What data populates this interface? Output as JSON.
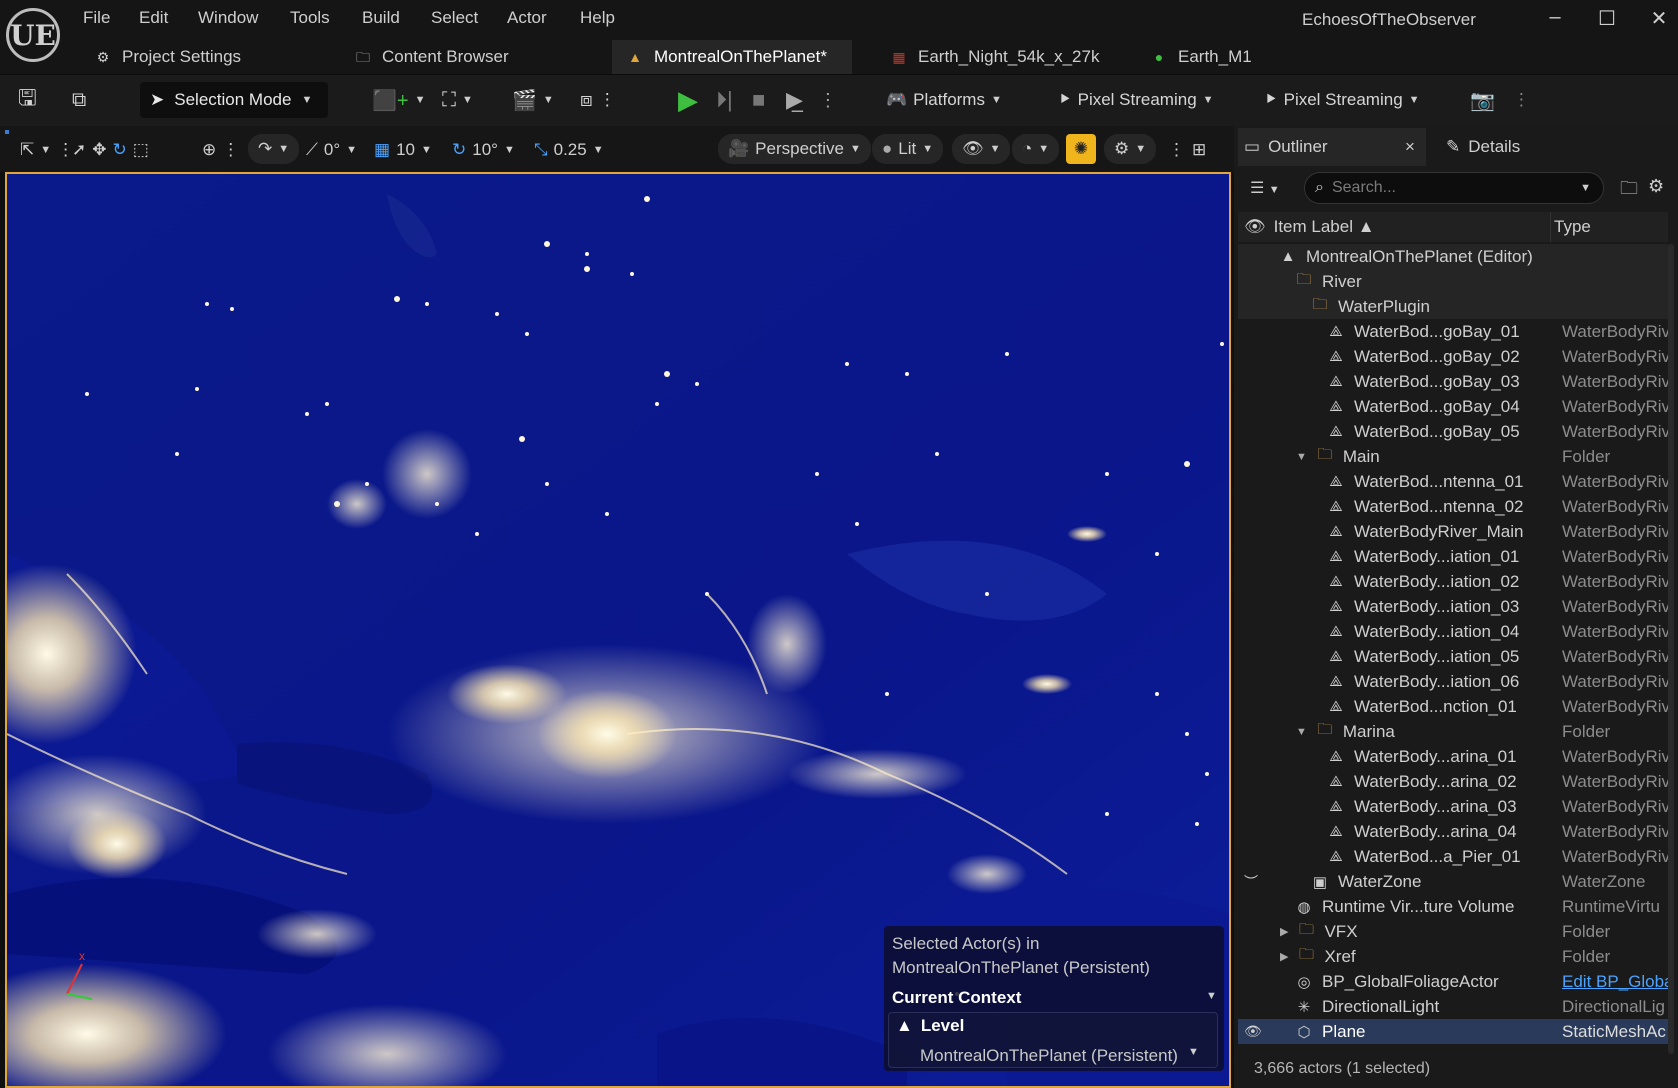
{
  "app": {
    "window_title": "EchoesOfTheObserver",
    "logo": "UE"
  },
  "menu": [
    "File",
    "Edit",
    "Window",
    "Tools",
    "Build",
    "Select",
    "Actor",
    "Help"
  ],
  "window_controls": {
    "minimize": "–",
    "maximize": "☐",
    "close": "✕"
  },
  "tabs": [
    {
      "label": "Project Settings",
      "icon": "gear-icon"
    },
    {
      "label": "Content Browser",
      "icon": "folder-icon"
    },
    {
      "label": "MontrealOnThePlanet*",
      "icon": "level-icon",
      "active": true
    },
    {
      "label": "Earth_Night_54k_x_27k",
      "icon": "texture-icon"
    },
    {
      "label": "Earth_M1",
      "icon": "material-icon"
    }
  ],
  "toolbar": {
    "mode": "Selection Mode",
    "platforms": "Platforms",
    "pixel_streaming_1": "Pixel Streaming",
    "pixel_streaming_2": "Pixel Streaming"
  },
  "viewport_toolbar": {
    "surface_snap": "0°",
    "grid_snap": "10",
    "rotation_snap": "10°",
    "scale_snap": "0.25",
    "view_mode": "Perspective",
    "lighting": "Lit"
  },
  "context_panel": {
    "line1": "Selected Actor(s) in",
    "line2": "MontrealOnThePlanet (Persistent)",
    "header": "Current Context",
    "level_label": "Level",
    "level_value": "MontrealOnThePlanet (Persistent)"
  },
  "outliner": {
    "tab": "Outliner",
    "details_tab": "Details",
    "search_placeholder": "Search...",
    "col_label": "Item Label ▲",
    "col_type": "Type",
    "status": "3,666 actors (1 selected)",
    "rows": [
      {
        "label": "MontrealOnThePlanet (Editor)",
        "type": "",
        "indent": 1,
        "icon": "level",
        "hl": true
      },
      {
        "label": "River",
        "type": "",
        "indent": 2,
        "icon": "folder",
        "hl": true
      },
      {
        "label": "WaterPlugin",
        "type": "",
        "indent": 3,
        "icon": "folder",
        "hl": true
      },
      {
        "label": "WaterBod...goBay_01",
        "type": "WaterBodyRiv",
        "indent": 4,
        "icon": "water"
      },
      {
        "label": "WaterBod...goBay_02",
        "type": "WaterBodyRiv",
        "indent": 4,
        "icon": "water"
      },
      {
        "label": "WaterBod...goBay_03",
        "type": "WaterBodyRiv",
        "indent": 4,
        "icon": "water"
      },
      {
        "label": "WaterBod...goBay_04",
        "type": "WaterBodyRiv",
        "indent": 4,
        "icon": "water"
      },
      {
        "label": "WaterBod...goBay_05",
        "type": "WaterBodyRiv",
        "indent": 4,
        "icon": "water"
      },
      {
        "label": "Main",
        "type": "Folder",
        "indent": 3,
        "icon": "folder",
        "expand": true
      },
      {
        "label": "WaterBod...ntenna_01",
        "type": "WaterBodyRiv",
        "indent": 4,
        "icon": "water"
      },
      {
        "label": "WaterBod...ntenna_02",
        "type": "WaterBodyRiv",
        "indent": 4,
        "icon": "water"
      },
      {
        "label": "WaterBodyRiver_Main",
        "type": "WaterBodyRiv",
        "indent": 4,
        "icon": "water"
      },
      {
        "label": "WaterBody...iation_01",
        "type": "WaterBodyRiv",
        "indent": 4,
        "icon": "water"
      },
      {
        "label": "WaterBody...iation_02",
        "type": "WaterBodyRiv",
        "indent": 4,
        "icon": "water"
      },
      {
        "label": "WaterBody...iation_03",
        "type": "WaterBodyRiv",
        "indent": 4,
        "icon": "water"
      },
      {
        "label": "WaterBody...iation_04",
        "type": "WaterBodyRiv",
        "indent": 4,
        "icon": "water"
      },
      {
        "label": "WaterBody...iation_05",
        "type": "WaterBodyRiv",
        "indent": 4,
        "icon": "water"
      },
      {
        "label": "WaterBody...iation_06",
        "type": "WaterBodyRiv",
        "indent": 4,
        "icon": "water"
      },
      {
        "label": "WaterBod...nction_01",
        "type": "WaterBodyRiv",
        "indent": 4,
        "icon": "water"
      },
      {
        "label": "Marina",
        "type": "Folder",
        "indent": 3,
        "icon": "folder",
        "expand": true
      },
      {
        "label": "WaterBody...arina_01",
        "type": "WaterBodyRiv",
        "indent": 4,
        "icon": "water"
      },
      {
        "label": "WaterBody...arina_02",
        "type": "WaterBodyRiv",
        "indent": 4,
        "icon": "water"
      },
      {
        "label": "WaterBody...arina_03",
        "type": "WaterBodyRiv",
        "indent": 4,
        "icon": "water"
      },
      {
        "label": "WaterBody...arina_04",
        "type": "WaterBodyRiv",
        "indent": 4,
        "icon": "water"
      },
      {
        "label": "WaterBod...a_Pier_01",
        "type": "WaterBodyRiv",
        "indent": 4,
        "icon": "water"
      },
      {
        "label": "WaterZone",
        "type": "WaterZone",
        "indent": 3,
        "icon": "zone",
        "eye": "hidden"
      },
      {
        "label": "Runtime Vir...ture Volume",
        "type": "RuntimeVirtu",
        "indent": 2,
        "icon": "volume"
      },
      {
        "label": "VFX",
        "type": "Folder",
        "indent": 2,
        "icon": "folder",
        "collapsed": true
      },
      {
        "label": "Xref",
        "type": "Folder",
        "indent": 2,
        "icon": "folder",
        "collapsed": true
      },
      {
        "label": "BP_GlobalFoliageActor",
        "type": "Edit BP_Globa",
        "indent": 2,
        "icon": "actor",
        "link": true
      },
      {
        "label": "DirectionalLight",
        "type": "DirectionalLig",
        "indent": 2,
        "icon": "light"
      },
      {
        "label": "Plane",
        "type": "StaticMeshAc",
        "indent": 2,
        "icon": "mesh",
        "selected": true,
        "eye": "visible"
      }
    ]
  },
  "colors": {
    "accent": "#e0a53b",
    "play": "#3fbf3f",
    "selection": "#2a3a5a",
    "viewport_sky": "#0a1580"
  }
}
